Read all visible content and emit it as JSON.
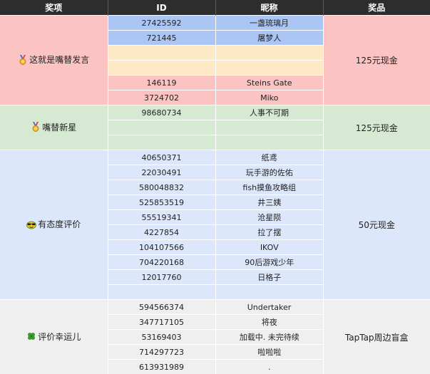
{
  "headers": {
    "category": "奖项",
    "id": "ID",
    "nickname": "昵称",
    "prize": "奖品"
  },
  "groups": [
    {
      "category": "这就是嘴替发言",
      "icon": "medal-icon",
      "prize": "125元现金",
      "rows": [
        {
          "id": "27425592",
          "nickname": "一盏琉璃月"
        },
        {
          "id": "721445",
          "nickname": "屠梦人"
        },
        {
          "id": "",
          "nickname": ""
        },
        {
          "id": "",
          "nickname": ""
        },
        {
          "id": "146119",
          "nickname": "Steins Gate"
        },
        {
          "id": "3724702",
          "nickname": "Miko"
        }
      ]
    },
    {
      "category": "嘴替新星",
      "icon": "medal-icon",
      "prize": "125元现金",
      "rows": [
        {
          "id": "98680734",
          "nickname": "人事不可期"
        },
        {
          "id": "",
          "nickname": ""
        },
        {
          "id": "",
          "nickname": ""
        }
      ]
    },
    {
      "category": "有态度评价",
      "icon": "sunglasses-face-icon",
      "prize": "50元现金",
      "rows": [
        {
          "id": "40650371",
          "nickname": "纸鸢"
        },
        {
          "id": "22030491",
          "nickname": "玩手游的佐佑"
        },
        {
          "id": "580048832",
          "nickname": "fish摸鱼攻略组"
        },
        {
          "id": "525853519",
          "nickname": "井三姨"
        },
        {
          "id": "55519341",
          "nickname": "沧星陨"
        },
        {
          "id": "4227854",
          "nickname": "拉了摆"
        },
        {
          "id": "104107566",
          "nickname": "IKOV"
        },
        {
          "id": "704220168",
          "nickname": "90后游戏少年"
        },
        {
          "id": "12017760",
          "nickname": "日格子"
        },
        {
          "id": "",
          "nickname": ""
        }
      ]
    },
    {
      "category": "评价幸运儿",
      "icon": "four-leaf-clover-icon",
      "prize": "TapTap周边盲盒",
      "rows": [
        {
          "id": "594566374",
          "nickname": "Undertaker"
        },
        {
          "id": "347717105",
          "nickname": "将夜"
        },
        {
          "id": "53169403",
          "nickname": "加载中. 未完待续"
        },
        {
          "id": "714297723",
          "nickname": "啦啦啦"
        },
        {
          "id": "613931989",
          "nickname": "."
        }
      ]
    }
  ],
  "colors": {
    "header_bg": "#2d2d2d",
    "group1_bg": "#fbc4c2",
    "group1_highlight_bg": "#abc5f4",
    "group1_pale_bg": "#fde9c6",
    "group2_bg": "#d6ead3",
    "group3_bg": "#dde7fb",
    "group4_bg": "#efefef"
  }
}
